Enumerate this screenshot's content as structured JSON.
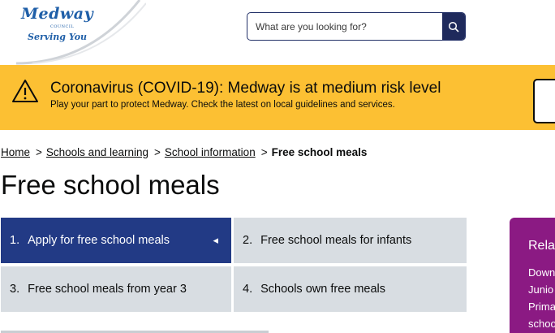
{
  "header": {
    "logo": {
      "name": "Medway",
      "council": "COUNCIL",
      "tagline": "Serving You"
    },
    "search": {
      "placeholder": "What are you looking for?",
      "button_icon": "search-icon"
    }
  },
  "banner": {
    "icon": "warning-icon",
    "title": "Coronavirus (COVID-19): Medway is at medium risk level",
    "text": "Play your part to protect Medway. Check the latest on local guidelines and services.",
    "color": "#fcc033"
  },
  "breadcrumb": {
    "items": [
      "Home",
      "Schools and learning",
      "School information"
    ],
    "separator": ">",
    "current": "Free school meals"
  },
  "page": {
    "title": "Free school meals"
  },
  "steps": [
    {
      "number": "1.",
      "label": "Apply for free school meals",
      "active": true
    },
    {
      "number": "2.",
      "label": "Free school meals for infants",
      "active": false
    },
    {
      "number": "3.",
      "label": "Free school meals from year 3",
      "active": false
    },
    {
      "number": "4.",
      "label": "Schools own free meals",
      "active": false
    }
  ],
  "related": {
    "title": "Rela",
    "links": [
      "Down",
      "Junio",
      "Prima",
      "schoo"
    ],
    "color": "#8b1a83"
  },
  "colors": {
    "accent": "#223a85",
    "step_bg": "#d8dde2"
  }
}
